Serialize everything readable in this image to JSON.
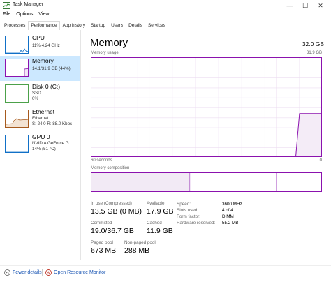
{
  "window": {
    "title": "Task Manager",
    "controls": {
      "minimize": "—",
      "maximize": "☐",
      "close": "✕"
    }
  },
  "menu": [
    "File",
    "Options",
    "View"
  ],
  "tabs": [
    "Processes",
    "Performance",
    "App history",
    "Startup",
    "Users",
    "Details",
    "Services"
  ],
  "active_tab": "Performance",
  "sidebar": {
    "items": [
      {
        "name": "CPU",
        "lines": [
          "11% 4.24 GHz"
        ],
        "color": "#1170c7"
      },
      {
        "name": "Memory",
        "lines": [
          "14.1/31.9 GB (44%)"
        ],
        "color": "#8b12ae",
        "selected": true
      },
      {
        "name": "Disk 0 (C:)",
        "lines": [
          "SSD",
          "0%"
        ],
        "color": "#4ca14a"
      },
      {
        "name": "Ethernet",
        "lines": [
          "Ethernet",
          "S: 24.0  R: 88.0 Kbps"
        ],
        "color": "#a65a1e"
      },
      {
        "name": "GPU 0",
        "lines": [
          "NVIDIA GeForce G...",
          "14% (51 °C)"
        ],
        "color": "#1170c7"
      }
    ]
  },
  "main": {
    "title": "Memory",
    "total": "32.0 GB",
    "usage_label": "Memory usage",
    "usage_max": "31.9 GB",
    "time_left": "60 seconds",
    "time_right": "0",
    "composition_label": "Memory composition",
    "usage_series": {
      "x_seconds_ago": [
        60,
        7,
        6,
        0
      ],
      "gb": [
        0,
        0,
        14.1,
        14.1
      ]
    },
    "composition": {
      "in_use_gb": 13.5,
      "modified_gb": 0.1,
      "standby_gb": 11.9,
      "free_gb": 6.4
    },
    "stats": [
      {
        "label": "In use (Compressed)",
        "value": "13.5 GB (0 MB)"
      },
      {
        "label": "Available",
        "value": "17.9 GB"
      },
      {
        "label": "Committed",
        "value": "19.0/36.7 GB"
      },
      {
        "label": "Cached",
        "value": "11.9 GB"
      },
      {
        "label": "Paged pool",
        "value": "673 MB"
      },
      {
        "label": "Non-paged pool",
        "value": "288 MB"
      }
    ],
    "kv": [
      {
        "label": "Speed:",
        "value": "3600 MHz"
      },
      {
        "label": "Slots used:",
        "value": "4 of 4"
      },
      {
        "label": "Form factor:",
        "value": "DIMM"
      },
      {
        "label": "Hardware reserved:",
        "value": "55.2 MB"
      }
    ]
  },
  "footer": {
    "fewer": "Fewer details",
    "resmon": "Open Resource Monitor"
  },
  "colors": {
    "accent": "#8b12ae",
    "selection": "#cce8ff",
    "link": "#1a56b4"
  }
}
